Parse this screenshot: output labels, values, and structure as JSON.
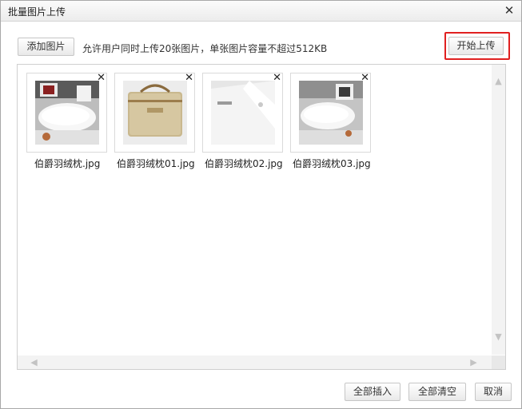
{
  "dialog": {
    "title": "批量图片上传",
    "close_glyph": "✕"
  },
  "toolbar": {
    "add_label": "添加图片",
    "hint": "允许用户同时上传20张图片，单张图片容量不超过512KB",
    "start_label": "开始上传"
  },
  "files": [
    {
      "name": "伯爵羽绒枕.jpg",
      "remove": "✕",
      "image": "pillow-photo"
    },
    {
      "name": "伯爵羽绒枕01.jpg",
      "remove": "✕",
      "image": "pillow-bag-photo"
    },
    {
      "name": "伯爵羽绒枕02.jpg",
      "remove": "✕",
      "image": "pillow-closeup-photo"
    },
    {
      "name": "伯爵羽绒枕03.jpg",
      "remove": "✕",
      "image": "pillow-photo"
    }
  ],
  "scrollbar": {
    "up": "▲",
    "down": "▼",
    "left": "◀",
    "right": "▶"
  },
  "footer": {
    "insert_all_label": "全部插入",
    "clear_all_label": "全部清空",
    "cancel_label": "取消"
  }
}
